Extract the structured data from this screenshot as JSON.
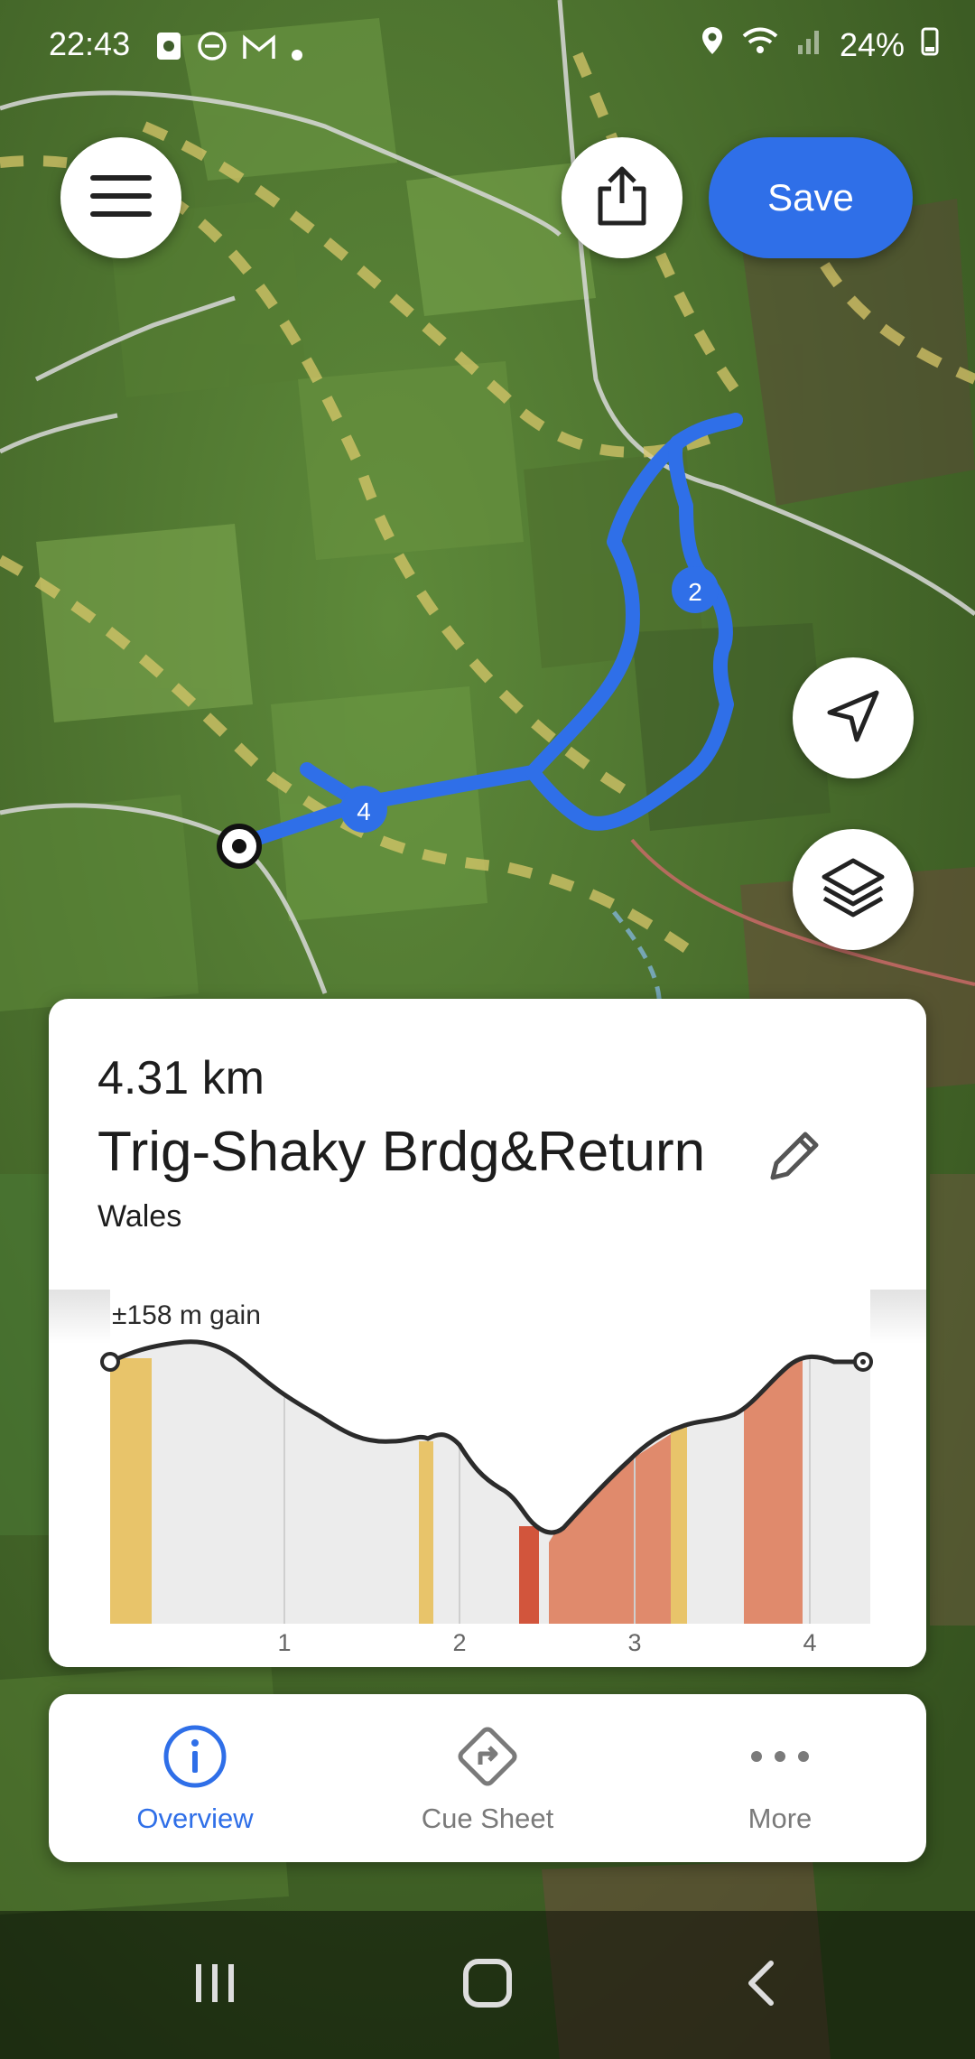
{
  "status_bar": {
    "time": "22:43",
    "battery": "24%",
    "left_icons": [
      "photo-icon",
      "dnd-icon",
      "gmail-icon",
      "dot-icon"
    ],
    "right_icons": [
      "location-icon",
      "wifi-icon",
      "signal-icon",
      "battery-icon"
    ]
  },
  "toolbar": {
    "save_label": "Save",
    "menu_icon": "hamburger-icon",
    "share_icon": "share-icon"
  },
  "map_controls": {
    "locate_icon": "navigation-arrow-icon",
    "layers_icon": "layers-icon"
  },
  "map": {
    "route_color": "#2f6fe8",
    "waypoints": [
      "2",
      "4"
    ],
    "start_marker": "start-marker-icon"
  },
  "route": {
    "distance": "4.31 km",
    "name": "Trig-Shaky Brdg&Return",
    "region": "Wales",
    "edit_icon": "pencil-icon"
  },
  "elevation": {
    "gain_label": "±158 m gain",
    "x_ticks": [
      "1",
      "2",
      "3",
      "4"
    ],
    "colors": {
      "moderate": "#e8c46a",
      "steep": "#e08a6c",
      "very_steep": "#d2553c",
      "background": "#ececec"
    }
  },
  "tabs": [
    {
      "label": "Overview",
      "icon": "info-icon",
      "active": true
    },
    {
      "label": "Cue Sheet",
      "icon": "turn-sign-icon",
      "active": false
    },
    {
      "label": "More",
      "icon": "more-dots-icon",
      "active": false
    }
  ],
  "system_nav": [
    "recents-icon",
    "home-icon",
    "back-icon"
  ],
  "accent_color": "#2f6fe8"
}
